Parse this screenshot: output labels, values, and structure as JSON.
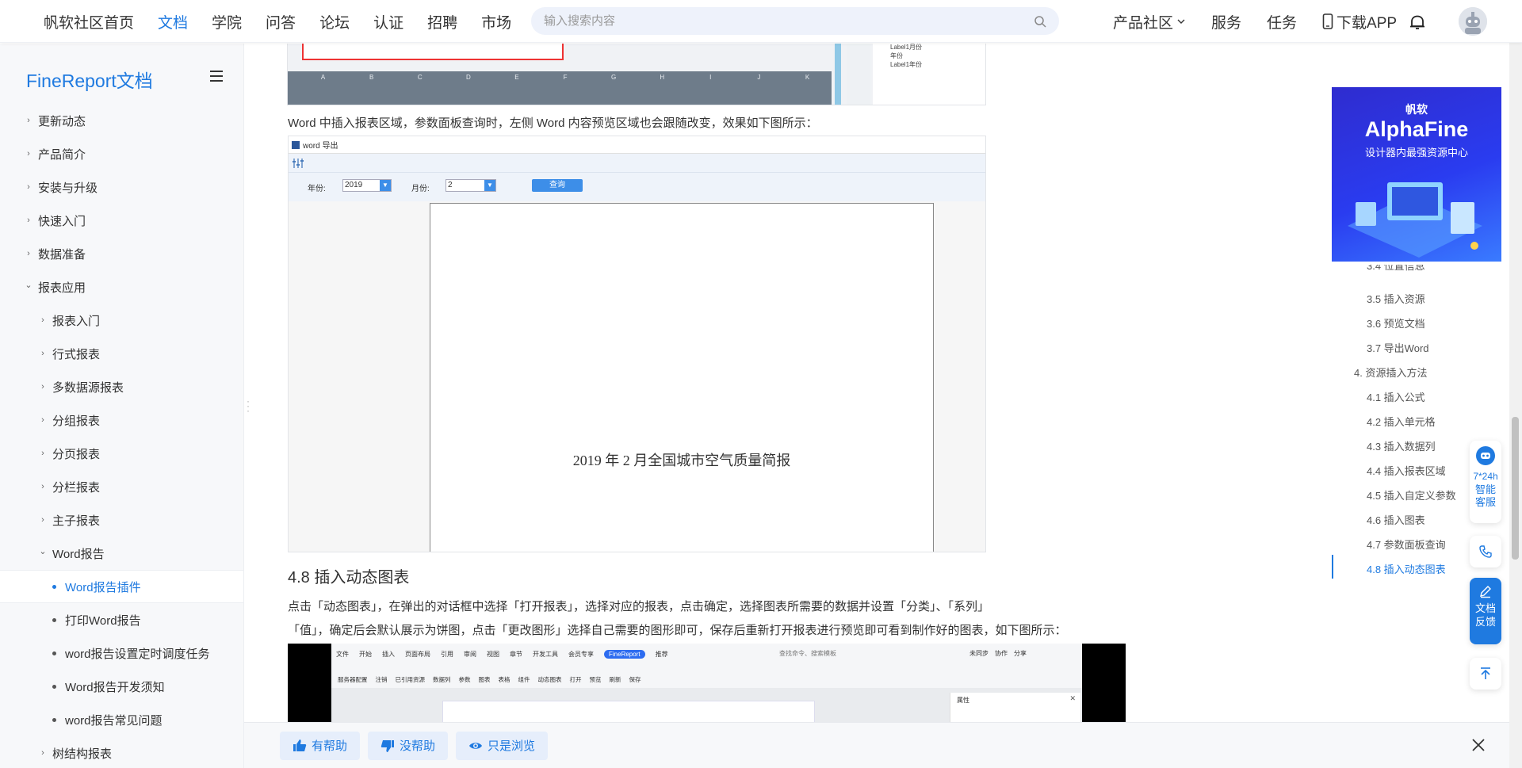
{
  "header": {
    "nav": [
      "帆软社区首页",
      "文档",
      "学院",
      "问答",
      "论坛",
      "认证",
      "招聘",
      "市场"
    ],
    "search_placeholder": "输入搜索内容",
    "right": [
      "产品社区",
      "服务",
      "任务",
      "下载APP"
    ]
  },
  "sidebar": {
    "title": "FineReport文档",
    "items": [
      {
        "label": "更新动态",
        "level": 1,
        "chevron": "›"
      },
      {
        "label": "产品简介",
        "level": 1,
        "chevron": "›"
      },
      {
        "label": "安装与升级",
        "level": 1,
        "chevron": "›"
      },
      {
        "label": "快速入门",
        "level": 1,
        "chevron": "›"
      },
      {
        "label": "数据准备",
        "level": 1,
        "chevron": "›"
      },
      {
        "label": "报表应用",
        "level": 1,
        "chevron": "⌄"
      },
      {
        "label": "报表入门",
        "level": 2,
        "chevron": "›"
      },
      {
        "label": "行式报表",
        "level": 2,
        "chevron": "›"
      },
      {
        "label": "多数据源报表",
        "level": 2,
        "chevron": "›"
      },
      {
        "label": "分组报表",
        "level": 2,
        "chevron": "›"
      },
      {
        "label": "分页报表",
        "level": 2,
        "chevron": "›"
      },
      {
        "label": "分栏报表",
        "level": 2,
        "chevron": "›"
      },
      {
        "label": "主子报表",
        "level": 2,
        "chevron": "›"
      },
      {
        "label": "Word报告",
        "level": 2,
        "chevron": "⌄"
      },
      {
        "label": "Word报告插件",
        "level": 3,
        "selected": true
      },
      {
        "label": "打印Word报告",
        "level": 3
      },
      {
        "label": "word报告设置定时调度任务",
        "level": 3
      },
      {
        "label": "Word报告开发须知",
        "level": 3
      },
      {
        "label": "word报告常见问题",
        "level": 3
      },
      {
        "label": "树结构报表",
        "level": 2,
        "chevron": "›"
      }
    ]
  },
  "content": {
    "para1": "Word 中插入报表区域，参数面板查询时，左侧 Word 内容预览区域也会跟随改变，效果如下图所示：",
    "shot2": {
      "window_title": "word 导出",
      "year_label": "年份:",
      "year_value": "2019",
      "month_label": "月份:",
      "month_value": "2",
      "query_button": "查询",
      "doc_heading": "2019 年 2 月全国城市空气质量简报"
    },
    "section_title": "4.8 插入动态图表",
    "para2": "点击「动态图表」，在弹出的对话框中选择「打开报表」，选择对应的报表，点击确定，选择图表所需要的数据并设置「分类」、「系列」",
    "para3": "「值」，确定后会默认展示为饼图，点击「更改图形」选择自己需要的图形即可，保存后重新打开报表进行预览即可看到制作好的图表，如下图所示：",
    "shot1_cols": [
      "A",
      "B",
      "C",
      "D",
      "E",
      "F",
      "G",
      "H",
      "I",
      "J",
      "K"
    ],
    "shot1_tree": [
      "Label1月份",
      "年份",
      "Label1年份"
    ],
    "shot3": {
      "menu": [
        "文件",
        "开始",
        "插入",
        "页面布局",
        "引用",
        "审阅",
        "视图",
        "章节",
        "开发工具",
        "会员专享",
        "FineReport",
        "推荐"
      ],
      "search": "查找命令、搜索模板",
      "right": [
        "未同步",
        "协作",
        "分享"
      ],
      "tools": [
        "服务器配置",
        "注销",
        "已引用资源",
        "数据列",
        "参数",
        "图表",
        "表格",
        "组件",
        "动态图表",
        "打开",
        "预览",
        "刷新",
        "保存"
      ],
      "panel": "属性"
    }
  },
  "ad": {
    "brand": "帆软",
    "title": "AlphaFine",
    "subtitle": "设计器内最强资源中心"
  },
  "toc": [
    {
      "label": "3.4 位置信息",
      "partial": true
    },
    {
      "label": "3.5 插入资源"
    },
    {
      "label": "3.6 预览文档"
    },
    {
      "label": "3.7 导出Word"
    },
    {
      "label": "4. 资源插入方法",
      "top": true
    },
    {
      "label": "4.1 插入公式"
    },
    {
      "label": "4.2 插入单元格"
    },
    {
      "label": "4.3 插入数据列"
    },
    {
      "label": "4.4 插入报表区域"
    },
    {
      "label": "4.5 插入自定义参数"
    },
    {
      "label": "4.6 插入图表"
    },
    {
      "label": "4.7 参数面板查询"
    },
    {
      "label": "4.8 插入动态图表",
      "active": true
    }
  ],
  "float": {
    "service": "7*24h",
    "service2": "智能客服",
    "feedback": "文档反馈"
  },
  "feedback": {
    "yes": "有帮助",
    "no": "没帮助",
    "browse": "只是浏览"
  },
  "colors": {
    "accent": "#1f7ae0",
    "sidebar_bg": "#f7f8fa"
  }
}
